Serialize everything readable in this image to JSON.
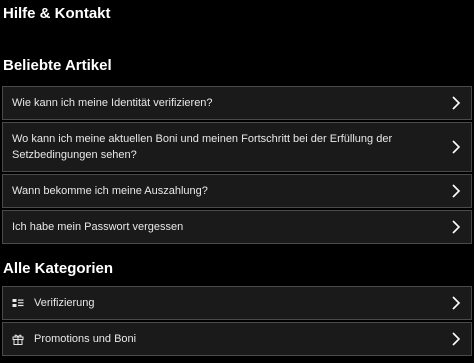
{
  "header": {
    "title": "Hilfe & Kontakt"
  },
  "popular": {
    "title": "Beliebte Artikel",
    "items": [
      {
        "label": "Wie kann ich meine Identität verifizieren?"
      },
      {
        "label": "Wo kann ich meine aktuellen Boni und meinen Fortschritt bei der Erfüllung der Setzbedingungen sehen?"
      },
      {
        "label": "Wann bekomme ich meine Auszahlung?"
      },
      {
        "label": "Ich habe mein Passwort vergessen"
      }
    ]
  },
  "categories": {
    "title": "Alle Kategorien",
    "items": [
      {
        "label": "Verifizierung",
        "icon": "id-card-icon"
      },
      {
        "label": "Promotions und Boni",
        "icon": "gift-icon"
      }
    ]
  },
  "colors": {
    "background": "#000000",
    "row_background": "#1a1a1a",
    "row_border": "#4a4a4a",
    "text": "#ffffff"
  }
}
